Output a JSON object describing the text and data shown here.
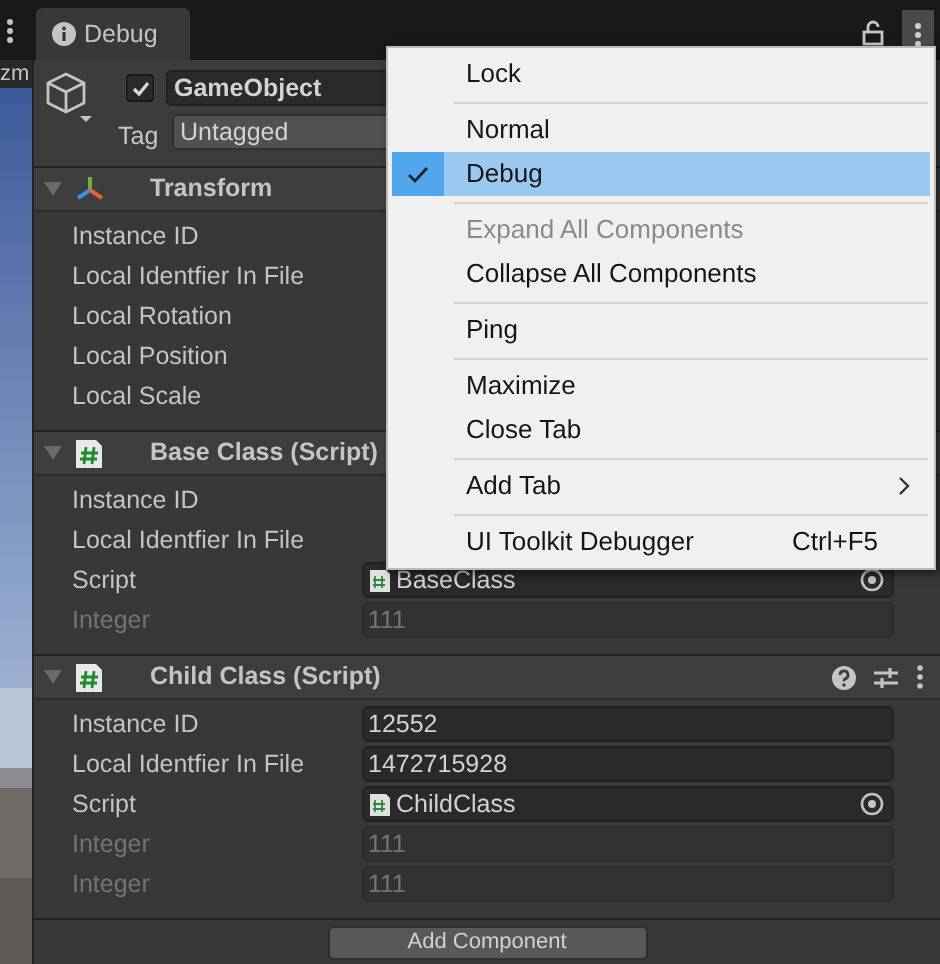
{
  "scene_strip": {
    "label": "zm"
  },
  "tab": {
    "label": "Debug"
  },
  "game_object": {
    "active": true,
    "name": "GameObject",
    "tag_label": "Tag",
    "tag": "Untagged"
  },
  "components": [
    {
      "title": "Transform",
      "kind": "transform",
      "expanded": true,
      "header_icons": false,
      "rows": [
        {
          "label": "Instance ID",
          "disabled": false
        },
        {
          "label": "Local Identfier In File",
          "disabled": false
        },
        {
          "label": "Local Rotation",
          "disabled": false
        },
        {
          "label": "Local Position",
          "disabled": false
        },
        {
          "label": "Local Scale",
          "disabled": false
        }
      ]
    },
    {
      "title": "Base Class (Script)",
      "kind": "script",
      "expanded": true,
      "header_icons": false,
      "rows": [
        {
          "label": "Instance ID",
          "disabled": false
        },
        {
          "label": "Local Identfier In File",
          "disabled": false
        },
        {
          "label": "Script",
          "disabled": false,
          "value": "BaseClass",
          "kind": "object"
        },
        {
          "label": "Integer",
          "disabled": true,
          "value": "111",
          "kind": "text"
        }
      ]
    },
    {
      "title": "Child Class (Script)",
      "kind": "script",
      "expanded": true,
      "header_icons": true,
      "rows": [
        {
          "label": "Instance ID",
          "disabled": false,
          "value": "12552",
          "kind": "text"
        },
        {
          "label": "Local Identfier In File",
          "disabled": false,
          "value": "1472715928",
          "kind": "text"
        },
        {
          "label": "Script",
          "disabled": false,
          "value": "ChildClass",
          "kind": "object"
        },
        {
          "label": "Integer",
          "disabled": true,
          "value": "111",
          "kind": "text"
        },
        {
          "label": "Integer",
          "disabled": true,
          "value": "111",
          "kind": "text"
        }
      ]
    }
  ],
  "add_component": "Add Component",
  "menu": {
    "items": [
      {
        "kind": "item",
        "label": "Lock",
        "checked": false,
        "selected": false,
        "disabled": false
      },
      {
        "kind": "separator"
      },
      {
        "kind": "item",
        "label": "Normal",
        "checked": false,
        "selected": false,
        "disabled": false
      },
      {
        "kind": "item",
        "label": "Debug",
        "checked": true,
        "selected": true,
        "disabled": false
      },
      {
        "kind": "separator"
      },
      {
        "kind": "item",
        "label": "Expand All Components",
        "checked": false,
        "selected": false,
        "disabled": true
      },
      {
        "kind": "item",
        "label": "Collapse All Components",
        "checked": false,
        "selected": false,
        "disabled": false
      },
      {
        "kind": "separator"
      },
      {
        "kind": "item",
        "label": "Ping",
        "checked": false,
        "selected": false,
        "disabled": false
      },
      {
        "kind": "separator"
      },
      {
        "kind": "item",
        "label": "Maximize",
        "checked": false,
        "selected": false,
        "disabled": false
      },
      {
        "kind": "item",
        "label": "Close Tab",
        "checked": false,
        "selected": false,
        "disabled": false
      },
      {
        "kind": "separator"
      },
      {
        "kind": "item",
        "label": "Add Tab",
        "checked": false,
        "selected": false,
        "disabled": false,
        "submenu": true
      },
      {
        "kind": "separator"
      },
      {
        "kind": "item",
        "label": "UI Toolkit Debugger",
        "checked": false,
        "selected": false,
        "disabled": false,
        "shortcut": "Ctrl+F5"
      }
    ]
  }
}
